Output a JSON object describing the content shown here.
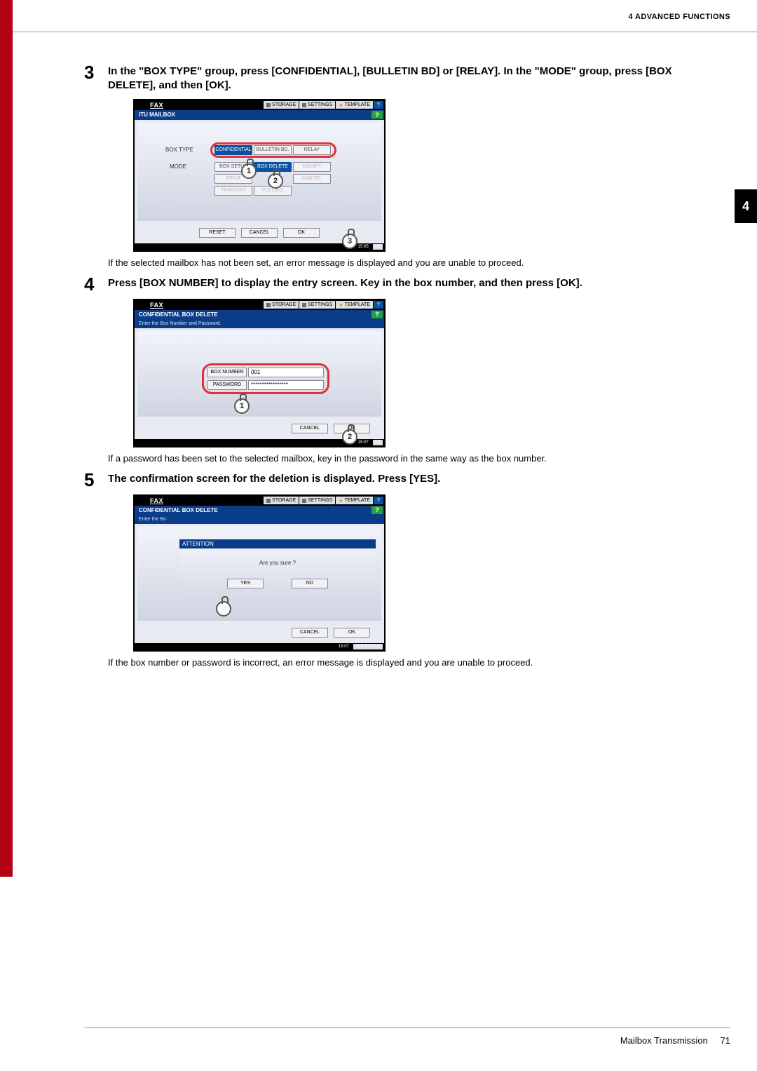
{
  "header": {
    "title": "4 ADVANCED FUNCTIONS"
  },
  "side_tab": "4",
  "footer": {
    "section": "Mailbox Transmission",
    "page": "71"
  },
  "steps": [
    {
      "num": "3",
      "title": "In the \"BOX TYPE\" group, press [CONFIDENTIAL], [BULLETIN BD] or [RELAY]. In the \"MODE\" group, press [BOX DELETE], and then [OK].",
      "note": "If the selected mailbox has not been set, an error message is displayed and you are unable to proceed."
    },
    {
      "num": "4",
      "title": "Press [BOX NUMBER] to display the entry screen. Key in the box number, and then press [OK].",
      "note": "If a password has been set to the selected mailbox, key in the password in the same way as the box number."
    },
    {
      "num": "5",
      "title": "The confirmation screen for the deletion is displayed. Press [YES].",
      "note": "If the box number or password is incorrect, an error message is displayed and you are unable to proceed."
    }
  ],
  "screens": {
    "s1": {
      "fax": "FAX",
      "topbtns": {
        "storage": "STORAGE",
        "settings": "SETTINGS",
        "template": "TEMPLATE"
      },
      "helpq": "?",
      "subtitle": "ITU MAILBOX",
      "hq": "?",
      "labels": {
        "box_type": "BOX TYPE",
        "mode": "MODE"
      },
      "grid1": {
        "a": "CONFIDENTIAL",
        "b": "BULLETIN BD.",
        "c": "RELAY"
      },
      "grid2": {
        "a": "BOX SETUP",
        "b": "BOX DELETE",
        "c": "MODIFY"
      },
      "grid3": {
        "a": "PRINT",
        "b": "CANCEL"
      },
      "grid4": {
        "a": "TRANSMIT",
        "b": "POLLING"
      },
      "bottom": {
        "reset": "RESET",
        "cancel": "CANCEL",
        "ok": "OK"
      },
      "footer_time": "15:05",
      "footer_us": "US",
      "markers": {
        "m1": "1",
        "m2": "2",
        "m3": "3"
      }
    },
    "s2": {
      "fax": "FAX",
      "topbtns": {
        "storage": "STORAGE",
        "settings": "SETTINGS",
        "template": "TEMPLATE"
      },
      "helpq": "?",
      "subtitle": "CONFIDENTIAL BOX DELETE",
      "hq": "?",
      "hint": "Enter the Box Number and Password.",
      "box_number_lbl": "BOX NUMBER",
      "box_number_val": "001",
      "password_lbl": "PASSWORD",
      "password_val": "*****************",
      "bottom": {
        "cancel": "CANCEL",
        "ok": "OK"
      },
      "footer_time": "15:07",
      "footer_us": "US",
      "markers": {
        "m1": "1",
        "m2": "2"
      }
    },
    "s3": {
      "fax": "FAX",
      "topbtns": {
        "storage": "STORAGE",
        "settings": "SETTINGS",
        "template": "TEMPLATE"
      },
      "helpq": "?",
      "subtitle": "CONFIDENTIAL BOX DELETE",
      "hq": "?",
      "hint": "Enter the Bo",
      "attention": "ATTENTION",
      "question": "Are you sure ?",
      "yes": "YES",
      "no": "NO",
      "bottom": {
        "cancel": "CANCEL",
        "ok": "OK"
      },
      "jobstatus": "JOB STATUS",
      "footer_time": "15:07"
    }
  }
}
